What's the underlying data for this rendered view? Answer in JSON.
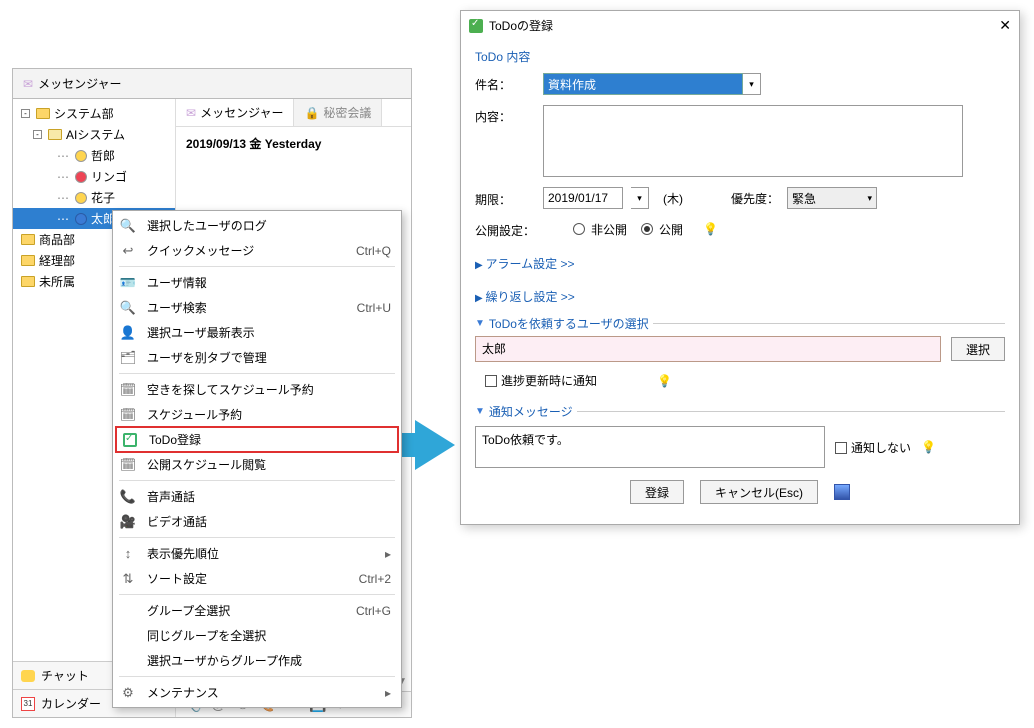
{
  "left": {
    "header": "メッセンジャー",
    "tabs": {
      "messenger": "メッセンジャー",
      "secret": "秘密会議"
    },
    "date_line": "2019/09/13 金 Yesterday",
    "tree": {
      "root": "システム部",
      "ai": "AIシステム",
      "u1": "哲郎",
      "u2": "リンゴ",
      "u3": "花子",
      "u4": "太郎",
      "dept2": "商品部",
      "dept3": "経理部",
      "dept4": "未所属"
    },
    "bottom": {
      "chat": "チャット",
      "calendar": "カレンダー",
      "cal_num": "31"
    }
  },
  "ctx": {
    "i1": "選択したユーザのログ",
    "i2": "クイックメッセージ",
    "s2": "Ctrl+Q",
    "i3": "ユーザ情報",
    "i4": "ユーザ検索",
    "s4": "Ctrl+U",
    "i5": "選択ユーザ最新表示",
    "i6": "ユーザを別タブで管理",
    "i7": "空きを探してスケジュール予約",
    "i8": "スケジュール予約",
    "i9": "ToDo登録",
    "i10": "公開スケジュール閲覧",
    "i11": "音声通話",
    "i12": "ビデオ通話",
    "i13": "表示優先順位",
    "i14": "ソート設定",
    "s14": "Ctrl+2",
    "i15": "グループ全選択",
    "s15": "Ctrl+G",
    "i16": "同じグループを全選択",
    "i17": "選択ユーザからグループ作成",
    "i18": "メンテナンス"
  },
  "dlg": {
    "title": "ToDoの登録",
    "section_content": "ToDo 内容",
    "lbl_subject": "件名：",
    "subject_value": "資料作成",
    "lbl_content": "内容：",
    "content_value": "",
    "lbl_deadline": "期限：",
    "deadline_value": "2019/01/17",
    "weekday": "(木)",
    "lbl_priority": "優先度：",
    "priority_value": "緊急",
    "lbl_visibility": "公開設定：",
    "vis_private": "非公開",
    "vis_public": "公開",
    "link_alarm": "アラーム設定 >>",
    "link_repeat": "繰り返し設定 >>",
    "section_user": "ToDoを依頼するユーザの選択",
    "user_value": "太郎",
    "btn_select": "選択",
    "chk_progress": "進捗更新時に通知",
    "section_notify": "通知メッセージ",
    "notify_value": "ToDo依頼です。",
    "chk_no_notify": "通知しない",
    "btn_register": "登録",
    "btn_cancel": "キャンセル(Esc)"
  }
}
